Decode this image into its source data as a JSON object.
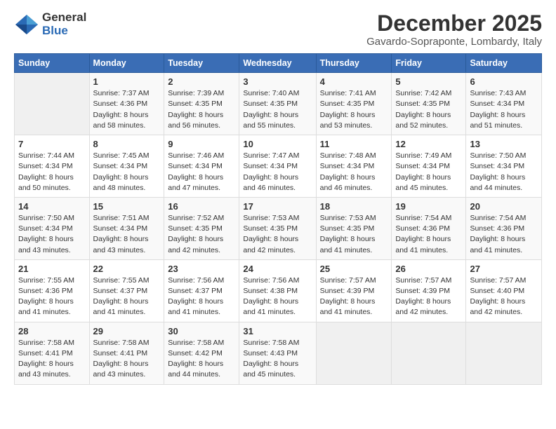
{
  "logo": {
    "general": "General",
    "blue": "Blue"
  },
  "title": {
    "month": "December 2025",
    "location": "Gavardo-Sopraponte, Lombardy, Italy"
  },
  "weekdays": [
    "Sunday",
    "Monday",
    "Tuesday",
    "Wednesday",
    "Thursday",
    "Friday",
    "Saturday"
  ],
  "weeks": [
    [
      {
        "day": "",
        "info": ""
      },
      {
        "day": "1",
        "info": "Sunrise: 7:37 AM\nSunset: 4:36 PM\nDaylight: 8 hours\nand 58 minutes."
      },
      {
        "day": "2",
        "info": "Sunrise: 7:39 AM\nSunset: 4:35 PM\nDaylight: 8 hours\nand 56 minutes."
      },
      {
        "day": "3",
        "info": "Sunrise: 7:40 AM\nSunset: 4:35 PM\nDaylight: 8 hours\nand 55 minutes."
      },
      {
        "day": "4",
        "info": "Sunrise: 7:41 AM\nSunset: 4:35 PM\nDaylight: 8 hours\nand 53 minutes."
      },
      {
        "day": "5",
        "info": "Sunrise: 7:42 AM\nSunset: 4:35 PM\nDaylight: 8 hours\nand 52 minutes."
      },
      {
        "day": "6",
        "info": "Sunrise: 7:43 AM\nSunset: 4:34 PM\nDaylight: 8 hours\nand 51 minutes."
      }
    ],
    [
      {
        "day": "7",
        "info": "Sunrise: 7:44 AM\nSunset: 4:34 PM\nDaylight: 8 hours\nand 50 minutes."
      },
      {
        "day": "8",
        "info": "Sunrise: 7:45 AM\nSunset: 4:34 PM\nDaylight: 8 hours\nand 48 minutes."
      },
      {
        "day": "9",
        "info": "Sunrise: 7:46 AM\nSunset: 4:34 PM\nDaylight: 8 hours\nand 47 minutes."
      },
      {
        "day": "10",
        "info": "Sunrise: 7:47 AM\nSunset: 4:34 PM\nDaylight: 8 hours\nand 46 minutes."
      },
      {
        "day": "11",
        "info": "Sunrise: 7:48 AM\nSunset: 4:34 PM\nDaylight: 8 hours\nand 46 minutes."
      },
      {
        "day": "12",
        "info": "Sunrise: 7:49 AM\nSunset: 4:34 PM\nDaylight: 8 hours\nand 45 minutes."
      },
      {
        "day": "13",
        "info": "Sunrise: 7:50 AM\nSunset: 4:34 PM\nDaylight: 8 hours\nand 44 minutes."
      }
    ],
    [
      {
        "day": "14",
        "info": "Sunrise: 7:50 AM\nSunset: 4:34 PM\nDaylight: 8 hours\nand 43 minutes."
      },
      {
        "day": "15",
        "info": "Sunrise: 7:51 AM\nSunset: 4:34 PM\nDaylight: 8 hours\nand 43 minutes."
      },
      {
        "day": "16",
        "info": "Sunrise: 7:52 AM\nSunset: 4:35 PM\nDaylight: 8 hours\nand 42 minutes."
      },
      {
        "day": "17",
        "info": "Sunrise: 7:53 AM\nSunset: 4:35 PM\nDaylight: 8 hours\nand 42 minutes."
      },
      {
        "day": "18",
        "info": "Sunrise: 7:53 AM\nSunset: 4:35 PM\nDaylight: 8 hours\nand 41 minutes."
      },
      {
        "day": "19",
        "info": "Sunrise: 7:54 AM\nSunset: 4:36 PM\nDaylight: 8 hours\nand 41 minutes."
      },
      {
        "day": "20",
        "info": "Sunrise: 7:54 AM\nSunset: 4:36 PM\nDaylight: 8 hours\nand 41 minutes."
      }
    ],
    [
      {
        "day": "21",
        "info": "Sunrise: 7:55 AM\nSunset: 4:36 PM\nDaylight: 8 hours\nand 41 minutes."
      },
      {
        "day": "22",
        "info": "Sunrise: 7:55 AM\nSunset: 4:37 PM\nDaylight: 8 hours\nand 41 minutes."
      },
      {
        "day": "23",
        "info": "Sunrise: 7:56 AM\nSunset: 4:37 PM\nDaylight: 8 hours\nand 41 minutes."
      },
      {
        "day": "24",
        "info": "Sunrise: 7:56 AM\nSunset: 4:38 PM\nDaylight: 8 hours\nand 41 minutes."
      },
      {
        "day": "25",
        "info": "Sunrise: 7:57 AM\nSunset: 4:39 PM\nDaylight: 8 hours\nand 41 minutes."
      },
      {
        "day": "26",
        "info": "Sunrise: 7:57 AM\nSunset: 4:39 PM\nDaylight: 8 hours\nand 42 minutes."
      },
      {
        "day": "27",
        "info": "Sunrise: 7:57 AM\nSunset: 4:40 PM\nDaylight: 8 hours\nand 42 minutes."
      }
    ],
    [
      {
        "day": "28",
        "info": "Sunrise: 7:58 AM\nSunset: 4:41 PM\nDaylight: 8 hours\nand 43 minutes."
      },
      {
        "day": "29",
        "info": "Sunrise: 7:58 AM\nSunset: 4:41 PM\nDaylight: 8 hours\nand 43 minutes."
      },
      {
        "day": "30",
        "info": "Sunrise: 7:58 AM\nSunset: 4:42 PM\nDaylight: 8 hours\nand 44 minutes."
      },
      {
        "day": "31",
        "info": "Sunrise: 7:58 AM\nSunset: 4:43 PM\nDaylight: 8 hours\nand 45 minutes."
      },
      {
        "day": "",
        "info": ""
      },
      {
        "day": "",
        "info": ""
      },
      {
        "day": "",
        "info": ""
      }
    ]
  ]
}
